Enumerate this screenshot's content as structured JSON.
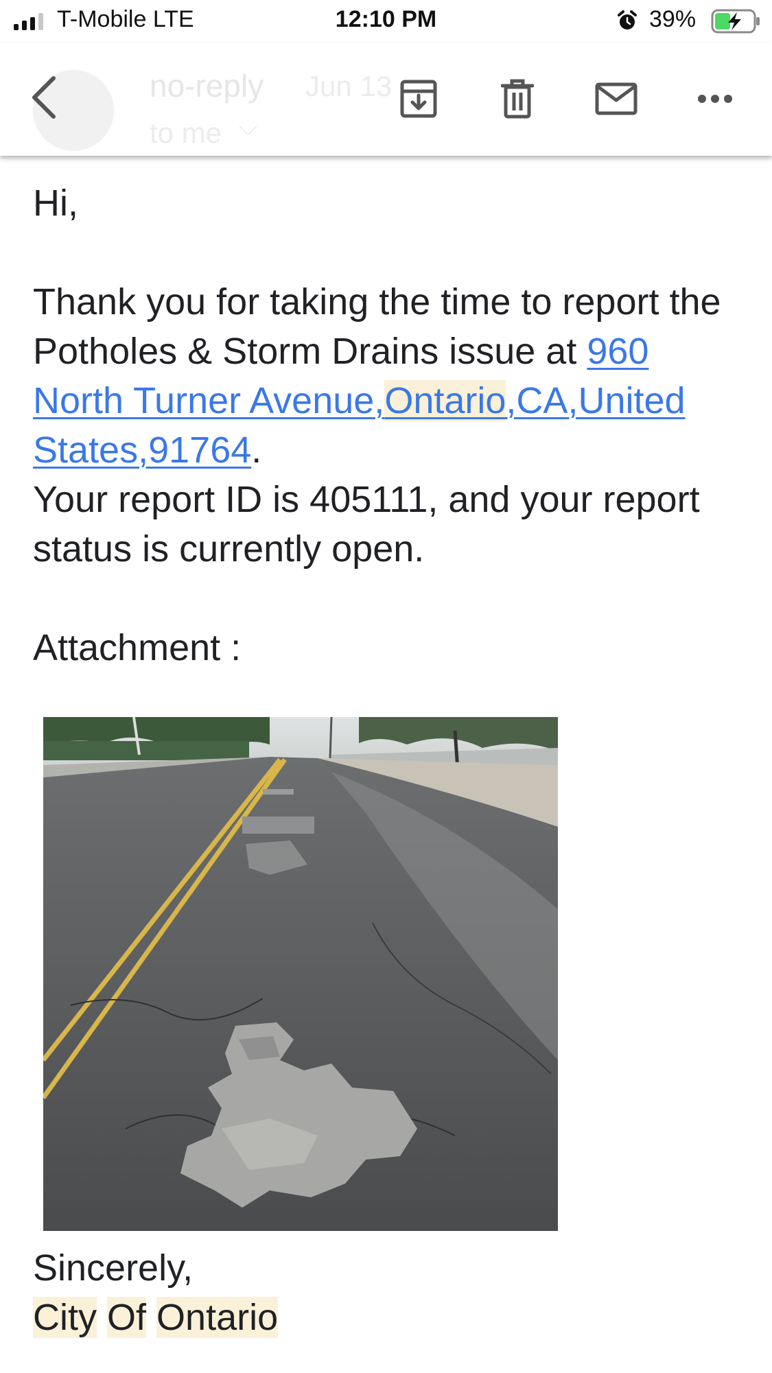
{
  "status_bar": {
    "carrier": "T-Mobile  LTE",
    "time": "12:10 PM",
    "battery_percent": "39%",
    "icons": [
      "signal-bars-icon",
      "alarm-icon",
      "battery-charging-icon"
    ],
    "battery_color": "#4cd964"
  },
  "toolbar": {
    "ghost_sender": "no-reply",
    "ghost_date": "Jun 13",
    "ghost_to": "to me",
    "actions": [
      "back-arrow-icon",
      "archive-icon",
      "trash-icon",
      "mail-icon",
      "more-dots-icon"
    ]
  },
  "email": {
    "greeting": "Hi,",
    "intro_text": "Thank you for taking the time to report the Potholes & Storm Drains issue at ",
    "address_part1": "960 North Turner Avenue,",
    "address_part2": "Ontario",
    "address_part3": ",CA,United States,91764",
    "period": ".",
    "status_text": "Your report ID is 405111, and your report status is currently open.",
    "attachment_label": "Attachment :",
    "closing": "Sincerely,",
    "sig_word1": "City",
    "sig_word2": "Of",
    "sig_word3": "Ontario"
  },
  "colors": {
    "link": "#3b78e7",
    "highlight": "#fbf1d9",
    "text": "#202124"
  }
}
